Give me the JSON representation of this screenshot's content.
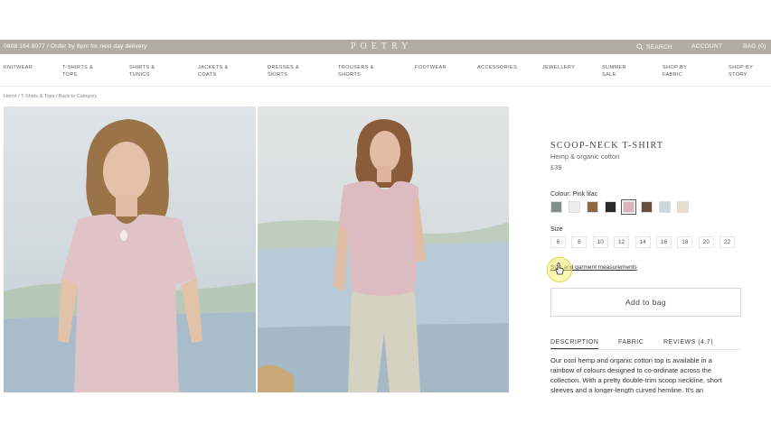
{
  "topbar": {
    "promo": "0808 164 8077 / Order by 8pm for next day delivery",
    "logo": "POETRY",
    "search": "SEARCH",
    "account": "ACCOUNT",
    "bag": "BAG (0)"
  },
  "nav": [
    "KNITWEAR",
    "T-SHIRTS & TOPS",
    "SHIRTS & TUNICS",
    "JACKETS & COATS",
    "DRESSES & SKIRTS",
    "TROUSERS & SHORTS",
    "FOOTWEAR",
    "ACCESSORIES",
    "JEWELLERY",
    "SUMMER SALE",
    "SHOP BY FABRIC",
    "SHOP BY STORY"
  ],
  "breadcrumb": "Home / T-Shirts & Tops / Back to Category",
  "product": {
    "title": "SCOOP-NECK T-SHIRT",
    "subtitle": "Hemp & organic cotton",
    "price": "£39",
    "colour_label": "Colour: Pink lilac",
    "swatches": [
      "#7f8f8c",
      "#ececec",
      "#8a6a3e",
      "#2a2a2a",
      "#d9b5bb",
      "#6b4e3f",
      "#c8d8de",
      "#e8dccd"
    ],
    "selected_swatch": 4,
    "size_label": "Size",
    "sizes": [
      "6",
      "8",
      "10",
      "12",
      "14",
      "16",
      "18",
      "20",
      "22"
    ],
    "measure_link": "Size and garment measurements",
    "add_to_bag": "Add to bag",
    "tabs": [
      "DESCRIPTION",
      "FABRIC",
      "REVIEWS (4.7)"
    ],
    "description": "Our cool hemp and organic cotton top is available in a rainbow of colours designed to co-ordinate across the collection. With a pretty double-trim scoop neckline, short sleeves and a longer-length curved hemline. It's an"
  }
}
